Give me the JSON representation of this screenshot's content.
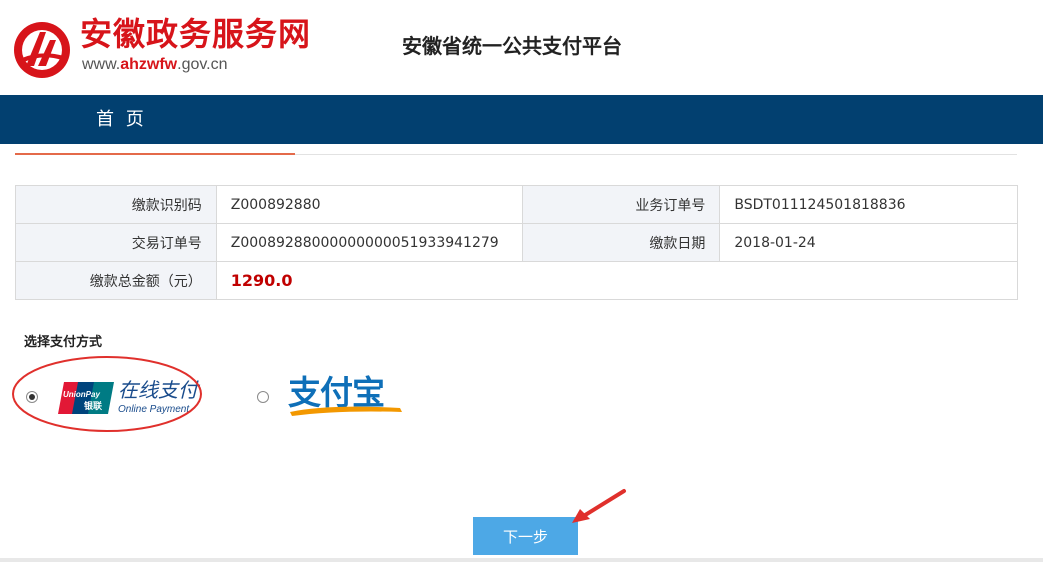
{
  "header": {
    "site_name": "安徽政务服务网",
    "site_url_prefix": "www.",
    "site_url_brand": "ahzwfw",
    "site_url_suffix": ".gov.cn",
    "platform_title": "安徽省统一公共支付平台",
    "logo_icon": "ahzwfw-logo-icon",
    "brand_color": "#d7141a"
  },
  "nav": {
    "home_label": "首 页",
    "bar_color": "#024070"
  },
  "order_info": {
    "rows": [
      {
        "label1": "缴款识别码",
        "value1": "Z000892880",
        "label2": "业务订单号",
        "value2": "BSDT011124501818836"
      },
      {
        "label1": "交易订单号",
        "value1": "Z00089288000000000051933941279",
        "label2": "缴款日期",
        "value2": "2018-01-24"
      }
    ],
    "total_label": "缴款总金额（元）",
    "total_value": "1290.0",
    "amount_color": "#c00000"
  },
  "payment": {
    "section_title": "选择支付方式",
    "options": [
      {
        "name": "unionpay",
        "text_cn": "在线支付",
        "text_en": "Online Payment",
        "logo_line1": "UnionPay",
        "logo_line2": "银联",
        "selected": true,
        "icon": "unionpay-logo-icon"
      },
      {
        "name": "alipay",
        "text_cn": "支付宝",
        "selected": false,
        "icon": "alipay-logo-icon"
      }
    ]
  },
  "actions": {
    "next_label": "下一步",
    "button_color": "#4da8e6"
  },
  "annotations": {
    "color": "#e0302c",
    "items": [
      "red-ellipse-around-unionpay",
      "red-arrow-pointing-to-next-button"
    ]
  }
}
